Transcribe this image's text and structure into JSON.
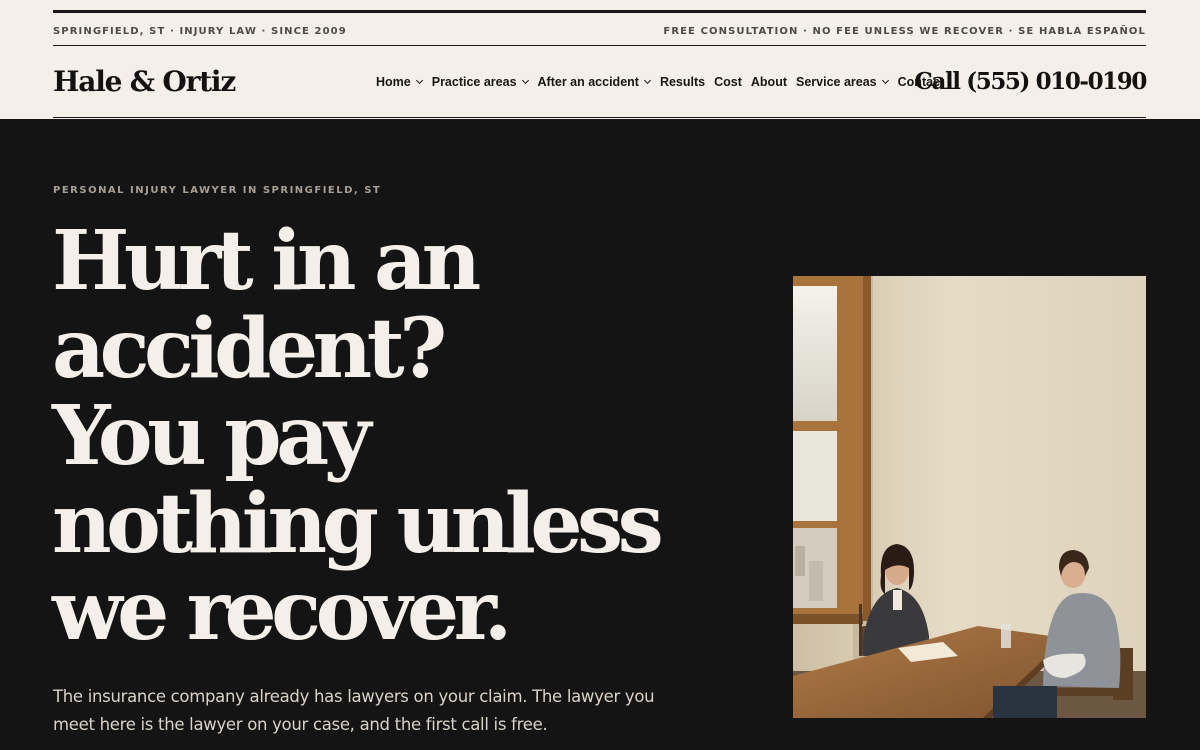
{
  "colors": {
    "header_bg": "#f4efe8",
    "hero_bg": "#151414",
    "ink": "#131211",
    "headline": "#f4efe8",
    "eyebrow": "#a89f94",
    "lede": "#d9d2c8"
  },
  "utility_bar": {
    "left": "SPRINGFIELD, ST · INJURY LAW · SINCE 2009",
    "right": "FREE CONSULTATION · NO FEE UNLESS WE RECOVER · SE HABLA ESPAÑOL"
  },
  "header": {
    "logo": "Hale & Ortiz",
    "phone": "Call (555) 010-0190"
  },
  "nav": {
    "items": [
      {
        "label": "Home",
        "icon": "chevron-down-icon"
      },
      {
        "label": "Practice areas",
        "icon": "chevron-down-icon"
      },
      {
        "label": "After an accident",
        "icon": "chevron-down-icon"
      },
      {
        "label": "Results"
      },
      {
        "label": "Cost"
      },
      {
        "label": "About"
      },
      {
        "label": "Service areas",
        "icon": "chevron-down-icon"
      },
      {
        "label": "Contact"
      }
    ]
  },
  "hero": {
    "eyebrow": "PERSONAL INJURY LAWYER IN SPRINGFIELD, ST",
    "headline_lines": [
      "Hurt in an",
      "accident?",
      "You pay",
      "nothing unless",
      "we recover."
    ],
    "lede": "The insurance company already has lawyers on your claim. The lawyer you meet here is the lawyer on your case, and the first call is free."
  }
}
